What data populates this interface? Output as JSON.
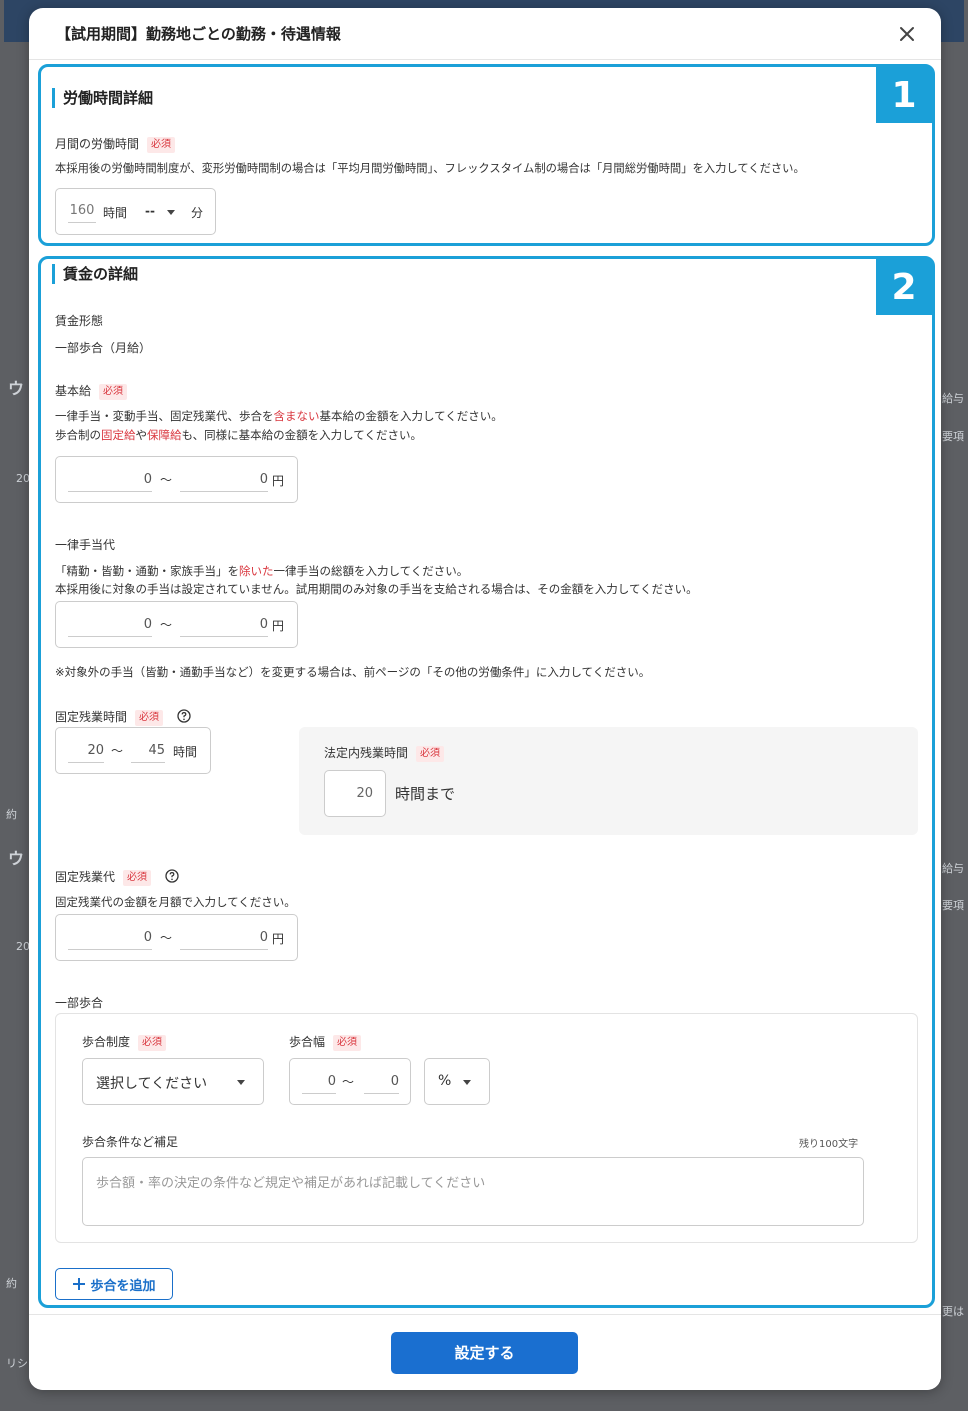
{
  "modal": {
    "title": "【試用期間】勤務地ごとの勤務・待遇情報",
    "submit_label": "設定する"
  },
  "section1": {
    "badge": "1",
    "title": "労働時間詳細",
    "monthly_hours": {
      "label": "月間の労働時間",
      "required": "必須",
      "description": "本採用後の労働時間制度が、変形労働時間制の場合は「平均月間労働時間」、フレックスタイム制の場合は「月間総労働時間」を入力してください。",
      "hours_value": "160",
      "hours_unit": "時間",
      "minutes_value": "--",
      "minutes_unit": "分"
    }
  },
  "section2": {
    "badge": "2",
    "title": "賃金の詳細",
    "wage_type": {
      "label": "賃金形態",
      "value": "一部歩合（月給）"
    },
    "base_salary": {
      "label": "基本給",
      "required": "必須",
      "desc1_a": "一律手当・変動手当、固定残業代、歩合を",
      "desc1_red": "含まない",
      "desc1_b": "基本給の金額を入力してください。",
      "desc2_a": "歩合制の",
      "desc2_red1": "固定給",
      "desc2_mid": "や",
      "desc2_red2": "保障給",
      "desc2_b": "も、同様に基本給の金額を入力してください。",
      "min": "0",
      "tilde": "〜",
      "max": "0",
      "unit": "円"
    },
    "allowance": {
      "label": "一律手当代",
      "desc1_a": "「精勤・皆勤・通勤・家族手当」を",
      "desc1_red": "除いた",
      "desc1_b": "一律手当の総額を入力してください。",
      "desc2": "本採用後に対象の手当は設定されていません。試用期間のみ対象の手当を支給される場合は、その金額を入力してください。",
      "min": "0",
      "tilde": "〜",
      "max": "0",
      "unit": "円",
      "note": "※対象外の手当（皆勤・通勤手当など）を変更する場合は、前ページの「その他の労働条件」に入力してください。"
    },
    "fixed_overtime_hours": {
      "label": "固定残業時間",
      "required": "必須",
      "min": "20",
      "tilde": "〜",
      "max": "45",
      "unit": "時間",
      "legal": {
        "label": "法定内残業時間",
        "required": "必須",
        "value": "20",
        "unit": "時間まで"
      }
    },
    "fixed_overtime_pay": {
      "label": "固定残業代",
      "required": "必須",
      "description": "固定残業代の金額を月額で入力してください。",
      "min": "0",
      "tilde": "〜",
      "max": "0",
      "unit": "円"
    },
    "commission": {
      "label": "一部歩合",
      "system_label": "歩合制度",
      "system_required": "必須",
      "system_select": "選択してください",
      "range_label": "歩合幅",
      "range_required": "必須",
      "range_min": "0",
      "range_tilde": "〜",
      "range_max": "0",
      "range_unit_select": "%",
      "notes_label": "歩合条件など補足",
      "notes_counter": "残り100文字",
      "notes_placeholder": "歩合額・率の決定の条件など規定や補足があれば記載してください",
      "add_button": "歩合を追加"
    }
  },
  "background": {
    "side_texts": [
      "ウ",
      "20",
      "約",
      "ウ",
      "20",
      "約",
      "リシ",
      "給与",
      "要項",
      "給与",
      "要項",
      "更は"
    ]
  }
}
